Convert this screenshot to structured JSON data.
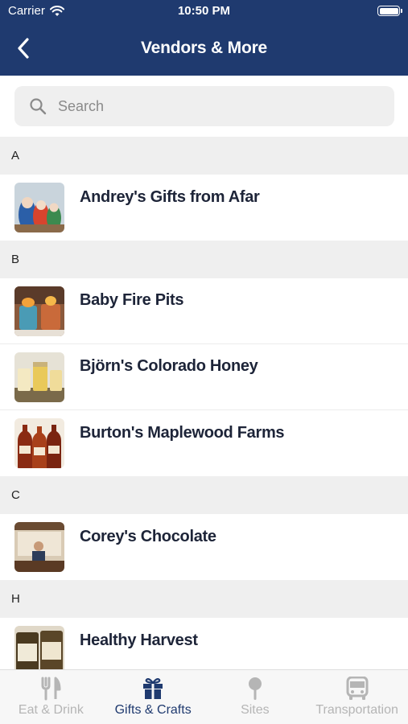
{
  "status_bar": {
    "carrier": "Carrier",
    "time": "10:50 PM"
  },
  "nav": {
    "title": "Vendors & More",
    "back_icon": "chevron-left-icon"
  },
  "search": {
    "placeholder": "Search",
    "value": ""
  },
  "sections": [
    {
      "letter": "A",
      "items": [
        {
          "name": "Andrey's Gifts from Afar",
          "thumb": "nesting-dolls"
        }
      ]
    },
    {
      "letter": "B",
      "items": [
        {
          "name": "Baby Fire Pits",
          "thumb": "fire-pits"
        },
        {
          "name": "Björn's Colorado Honey",
          "thumb": "honey-jars"
        },
        {
          "name": "Burton's Maplewood Farms",
          "thumb": "maple-syrup"
        }
      ]
    },
    {
      "letter": "C",
      "items": [
        {
          "name": "Corey's Chocolate",
          "thumb": "chocolate-shop"
        }
      ]
    },
    {
      "letter": "H",
      "items": [
        {
          "name": "Healthy Harvest",
          "thumb": "jars"
        }
      ]
    }
  ],
  "tabs": [
    {
      "label": "Eat & Drink",
      "icon": "fork-knife-icon",
      "active": false
    },
    {
      "label": "Gifts & Crafts",
      "icon": "gift-icon",
      "active": true
    },
    {
      "label": "Sites",
      "icon": "map-pin-icon",
      "active": false
    },
    {
      "label": "Transportation",
      "icon": "bus-icon",
      "active": false
    }
  ],
  "colors": {
    "header": "#1f3a6f",
    "section_bg": "#efefef",
    "tab_active": "#1f3a6f",
    "tab_inactive": "#b5b5b5"
  }
}
